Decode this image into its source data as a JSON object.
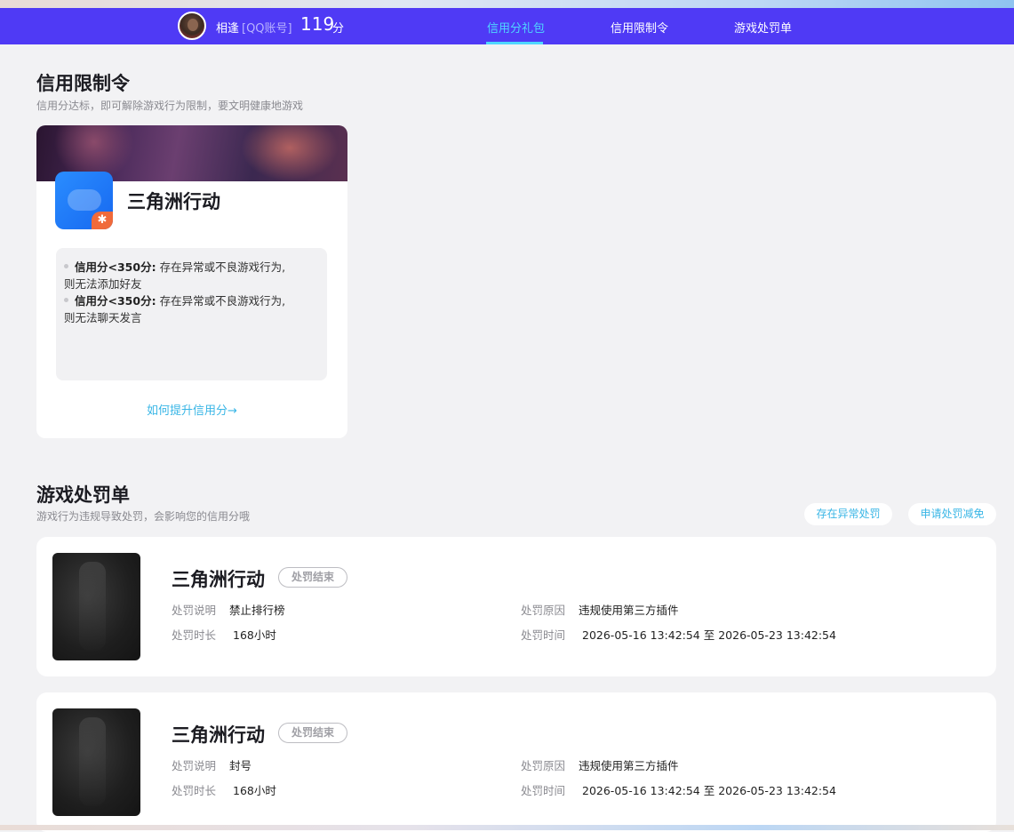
{
  "navbar": {
    "username": "相逢",
    "account_type": "[QQ账号]",
    "score": "119",
    "score_unit": "分",
    "tabs": [
      {
        "label": "信用分礼包",
        "active": true
      },
      {
        "label": "信用限制令",
        "active": false
      },
      {
        "label": "游戏处罚单",
        "active": false
      }
    ],
    "bg_color": "#4f3af5",
    "active_color": "#4fd7ff"
  },
  "restrictions": {
    "title": "信用限制令",
    "subtitle": "信用分达标，即可解除游戏行为限制，要文明健康地游戏",
    "card": {
      "game_name": "三角洲行动",
      "rules": [
        {
          "condition": "信用分<350分:",
          "text_line1": "存在异常或不良游戏行为,",
          "text_line2": "则无法添加好友"
        },
        {
          "condition": "信用分<350分:",
          "text_line1": "存在异常或不良游戏行为,",
          "text_line2": "则无法聊天发言"
        }
      ],
      "link": "如何提升信用分→"
    }
  },
  "penalties": {
    "title": "游戏处罚单",
    "subtitle": "游戏行为违规导致处罚，会影响您的信用分哦",
    "actions": {
      "abnormal": "存在异常处罚",
      "appeal": "申请处罚减免"
    },
    "labels": {
      "desc": "处罚说明",
      "duration": "处罚时长",
      "reason": "处罚原因",
      "time": "处罚时间"
    },
    "items": [
      {
        "game": "三角洲行动",
        "status": "处罚结束",
        "desc": "禁止排行榜",
        "duration": "168小时",
        "reason": "违规使用第三方插件",
        "time": "2026-05-16 13:42:54 至 2026-05-23 13:42:54"
      },
      {
        "game": "三角洲行动",
        "status": "处罚结束",
        "desc": "封号",
        "duration": "168小时",
        "reason": "违规使用第三方插件",
        "time": "2026-05-16 13:42:54 至 2026-05-23 13:42:54"
      }
    ]
  }
}
